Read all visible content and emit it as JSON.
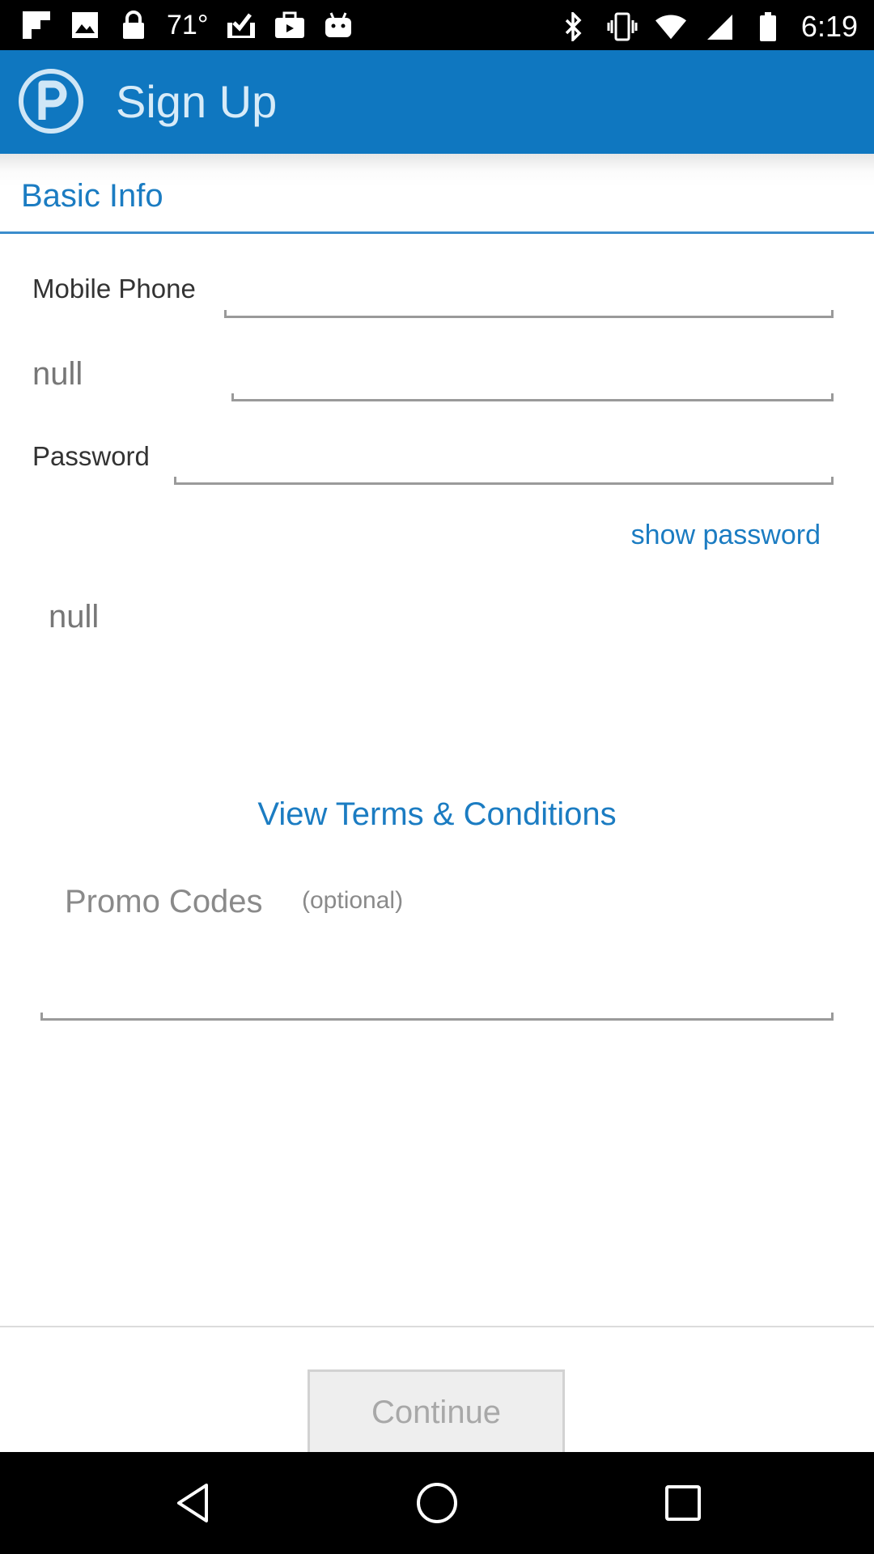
{
  "status_bar": {
    "temperature": "71°",
    "time": "6:19",
    "left_icons": [
      "flipboard-icon",
      "image-icon",
      "lock-icon",
      "weather-text",
      "check-box-icon",
      "briefcase-icon",
      "android-icon"
    ],
    "right_icons": [
      "bluetooth-icon",
      "vibrate-icon",
      "wifi-icon",
      "signal-icon",
      "battery-icon"
    ]
  },
  "app_bar": {
    "title": "Sign Up",
    "logo_icon": "p-logo-icon",
    "color": "#0f77c0"
  },
  "section": {
    "title": "Basic Info"
  },
  "form": {
    "mobile_phone_label": "Mobile Phone",
    "null_label_1": "null",
    "password_label": "Password",
    "show_password": "show password",
    "null_label_2": "null",
    "terms_link": "View Terms & Conditions",
    "promo_label": "Promo Codes",
    "promo_optional": "(optional)"
  },
  "actions": {
    "continue_label": "Continue"
  },
  "nav_bar": {
    "icons": [
      "back-icon",
      "home-icon",
      "recents-icon"
    ]
  },
  "colors": {
    "accent": "#1b7cc2",
    "header": "#0f77c0"
  }
}
